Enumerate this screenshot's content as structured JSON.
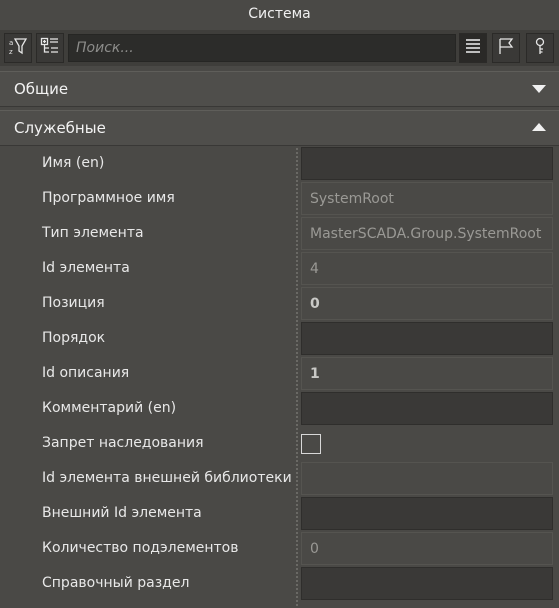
{
  "window": {
    "title": "Система"
  },
  "toolbar": {
    "sort_icon": "sort-filter-icon",
    "expand_icon": "expand-tree-icon",
    "search_placeholder": "Поиск...",
    "list_icon": "list-view-icon",
    "flag_icon": "flag-icon",
    "key_icon": "key-icon"
  },
  "sections": [
    {
      "label": "Общие",
      "state": "collapsed"
    },
    {
      "label": "Служебные",
      "state": "expanded"
    }
  ],
  "rows": [
    {
      "label": "Имя (en)",
      "value": "",
      "editable": true
    },
    {
      "label": "Программное имя",
      "value": "SystemRoot",
      "editable": false
    },
    {
      "label": "Тип элемента",
      "value": "MasterSCADA.Group.SystemRoot",
      "editable": false
    },
    {
      "label": "Id элемента",
      "value": "4",
      "editable": false
    },
    {
      "label": "Позиция",
      "value": "0",
      "editable": false,
      "bold": true
    },
    {
      "label": "Порядок",
      "value": "",
      "editable": true
    },
    {
      "label": "Id описания",
      "value": "1",
      "editable": false,
      "bold": true
    },
    {
      "label": "Комментарий (en)",
      "value": "",
      "editable": true
    },
    {
      "label": "Запрет наследования",
      "value": false,
      "type": "checkbox"
    },
    {
      "label": "Id элемента внешней библиотеки",
      "value": "",
      "editable": false
    },
    {
      "label": "Внешний Id элемента",
      "value": "",
      "editable": true
    },
    {
      "label": "Количество подэлементов",
      "value": "0",
      "editable": false
    },
    {
      "label": "Справочный раздел",
      "value": "",
      "editable": true
    }
  ],
  "colors": {
    "background": "#4a4946",
    "toolbar": "#3f3e3b",
    "section": "#4f4e4b",
    "text": "#e6e6e6",
    "readonly_text": "#9a9995"
  }
}
